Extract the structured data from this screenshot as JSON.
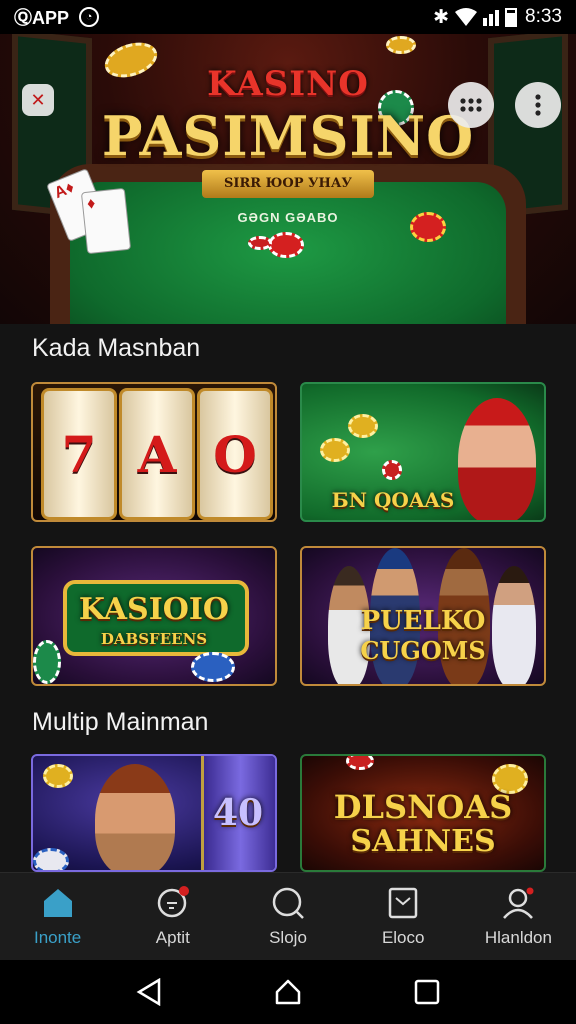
{
  "status_bar": {
    "app_label": "ⓆAPP",
    "time": "8:33"
  },
  "hero": {
    "title_top": "KASINO",
    "title": "PASIMSINO",
    "ribbon": "SIRR ЮОР УНАУ",
    "subtitle": "GƏGN GƏABO"
  },
  "sections": [
    {
      "title": "Kada Masnban"
    },
    {
      "title": "Multip Mainman"
    }
  ],
  "tiles": {
    "slots": {
      "reels": [
        "7",
        "A",
        "O"
      ]
    },
    "green": {
      "label": "БN QOAAS"
    },
    "kasioio": {
      "line1": "KASIOIO",
      "line2": "DABSFEENS"
    },
    "puelko": {
      "line1": "PUELKO",
      "line2": "CUGOMS"
    },
    "singer": {
      "reel_text": "40"
    },
    "dlsnoas": {
      "line1": "DLSNOAS",
      "line2": "SAHNES"
    }
  },
  "bottom_nav": {
    "items": [
      {
        "label": "Inonte",
        "icon": "home-icon",
        "active": true
      },
      {
        "label": "Aptit",
        "icon": "chat-icon",
        "active": false
      },
      {
        "label": "Slojo",
        "icon": "search-icon",
        "active": false
      },
      {
        "label": "Eloco",
        "icon": "bag-icon",
        "active": false
      },
      {
        "label": "Hlanldon",
        "icon": "profile-icon",
        "active": false
      }
    ]
  },
  "colors": {
    "accent": "#3aa0c8",
    "gold": "#f6d24a",
    "background": "#141414"
  }
}
